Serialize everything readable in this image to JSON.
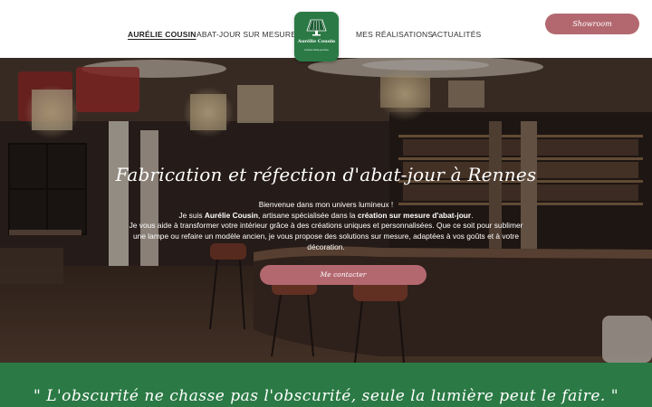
{
  "nav": {
    "items": [
      {
        "label": "AURÉLIE COUSIN"
      },
      {
        "label": "ABAT-JOUR SUR MESURE"
      },
      {
        "label": "MES RÉALISATIONS"
      },
      {
        "label": "ACTUALITÉS"
      }
    ]
  },
  "logo": {
    "name": "Aurélie Cousin",
    "subtitle": "Artisan Abat-jouriste"
  },
  "header": {
    "showroom_label": "Showroom"
  },
  "hero": {
    "title": "Fabrication et réfection d'abat-jour à Rennes",
    "welcome": "Bienvenue dans mon univers lumineux !",
    "intro_before": "Je suis ",
    "intro_name": "Aurélie Cousin",
    "intro_middle": ", artisane spécialisée dans la ",
    "intro_specialty": "création sur mesure d'abat-jour",
    "intro_after": ".",
    "body": "Je vous aide à transformer votre intérieur grâce à des créations uniques et personnalisées. Que ce soit pour sublimer une lampe ou refaire un modèle ancien, je vous propose des solutions sur mesure, adaptées à vos goûts et à votre décoration.",
    "cta_label": "Me contacter"
  },
  "quote": {
    "text": "\" L'obscurité ne chasse pas l'obscurité, seule la lumière peut le faire. \""
  },
  "colors": {
    "brand_green": "#2b7a45",
    "accent_rose": "#b3686f",
    "header_bg": "#ffffff"
  }
}
